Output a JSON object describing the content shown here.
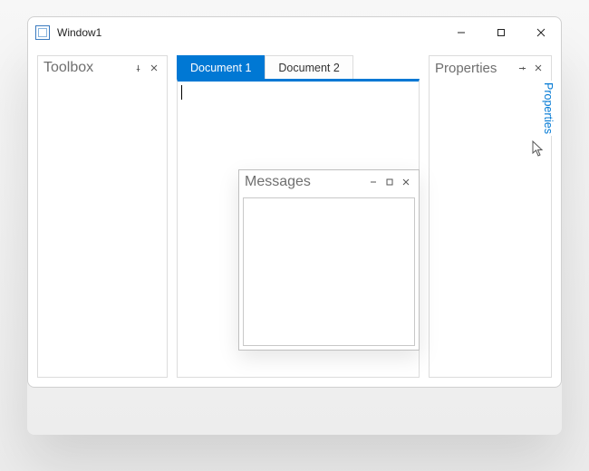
{
  "window": {
    "title": "Window1"
  },
  "panels": {
    "toolbox": {
      "title": "Toolbox"
    },
    "properties": {
      "title": "Properties"
    },
    "messages": {
      "title": "Messages"
    }
  },
  "autohide": {
    "properties_label": "Properties"
  },
  "documents": {
    "tabs": [
      {
        "label": "Document 1"
      },
      {
        "label": "Document 2"
      }
    ],
    "active_index": 0
  }
}
